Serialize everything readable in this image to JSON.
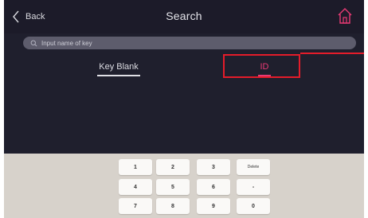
{
  "header": {
    "back_label": "Back",
    "title": "Search",
    "home_icon": "home-icon"
  },
  "search": {
    "placeholder": "Input name of key",
    "icon": "search-icon"
  },
  "tabs": [
    {
      "label": "Key Blank",
      "active": false
    },
    {
      "label": "ID",
      "active": true
    }
  ],
  "keypad": {
    "rows": [
      [
        "1",
        "2",
        "3",
        "Delete"
      ],
      [
        "4",
        "5",
        "6",
        "-"
      ],
      [
        "7",
        "8",
        "9",
        "0"
      ]
    ]
  },
  "colors": {
    "background": "#1f1f2d",
    "accent": "#e83a74",
    "annotation": "#e41c2a",
    "keypad_bg": "#d7d2cb"
  }
}
